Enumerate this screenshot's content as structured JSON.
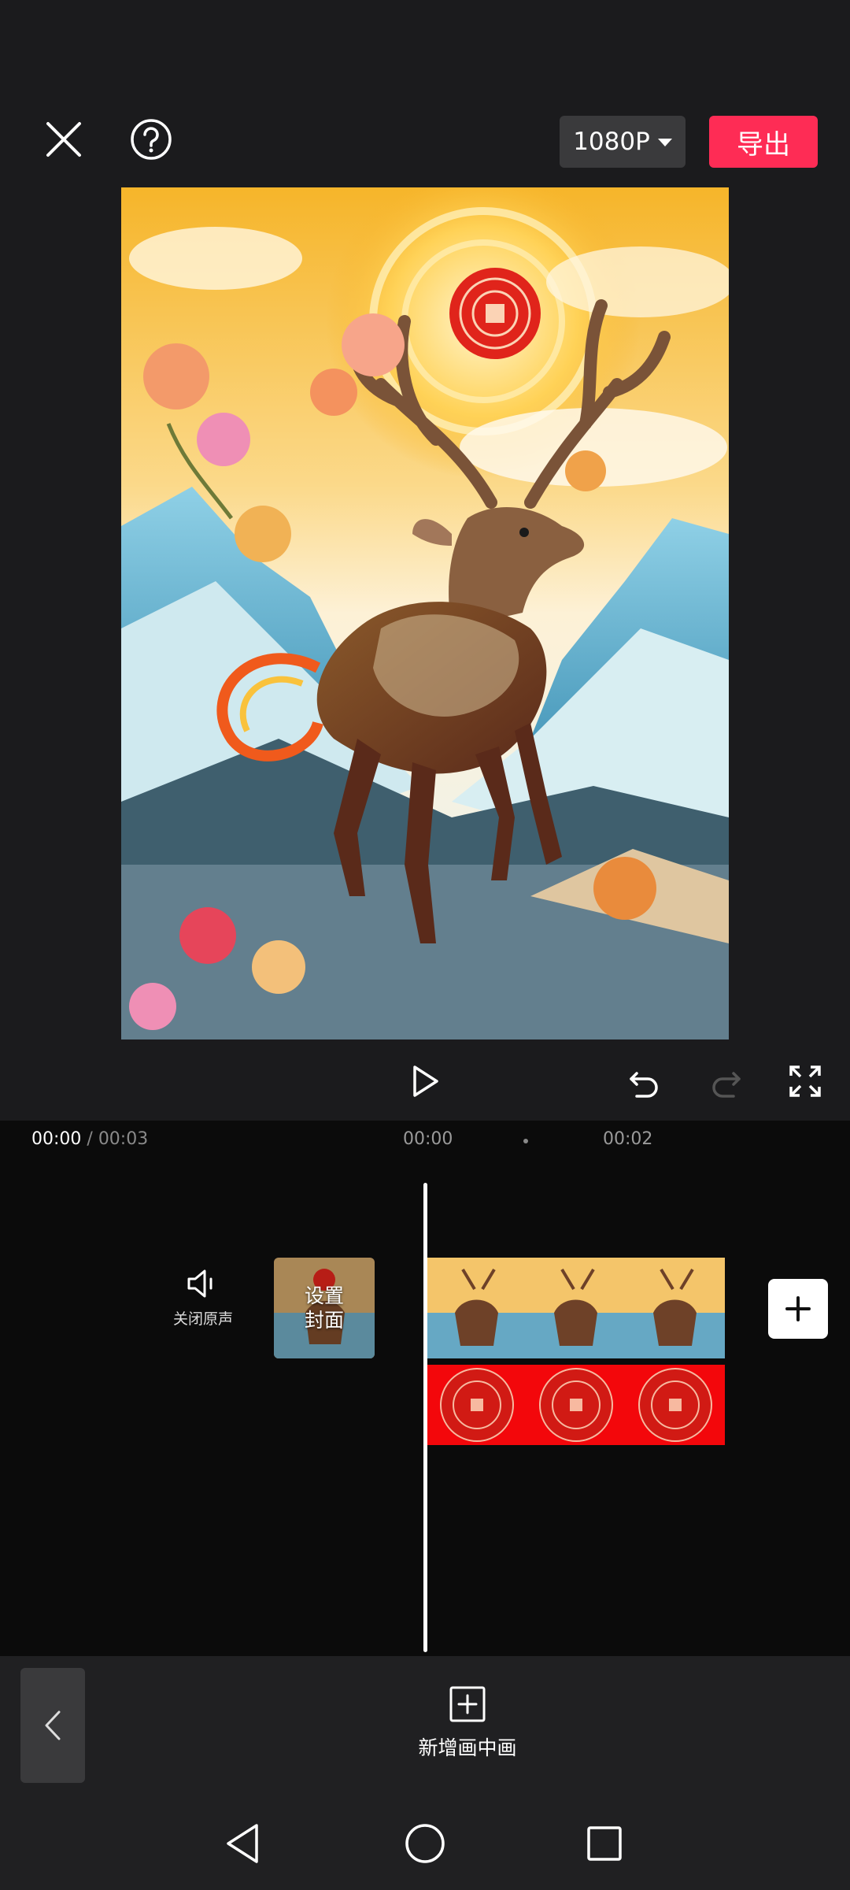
{
  "toolbar": {
    "resolution": "1080P",
    "export_label": "导出"
  },
  "playback": {
    "current_time": "00:00",
    "separator": " / ",
    "total_time": "00:03"
  },
  "ruler": {
    "labels": [
      "00:00",
      "00:02"
    ]
  },
  "timeline": {
    "mute_label": "关闭原声",
    "cover_label_line1": "设置",
    "cover_label_line2": "封面"
  },
  "bottom": {
    "add_pip_label": "新增画中画"
  },
  "colors": {
    "accent_export": "#fe2c55",
    "overlay_track": "#f3070b"
  },
  "icons": [
    "close-icon",
    "help-icon",
    "chevron-down-icon",
    "play-icon",
    "undo-icon",
    "redo-icon",
    "fullscreen-icon",
    "speaker-icon",
    "plus-icon",
    "chevron-left-icon",
    "add-box-icon",
    "triangle-back-icon",
    "circle-home-icon",
    "square-recent-icon"
  ]
}
